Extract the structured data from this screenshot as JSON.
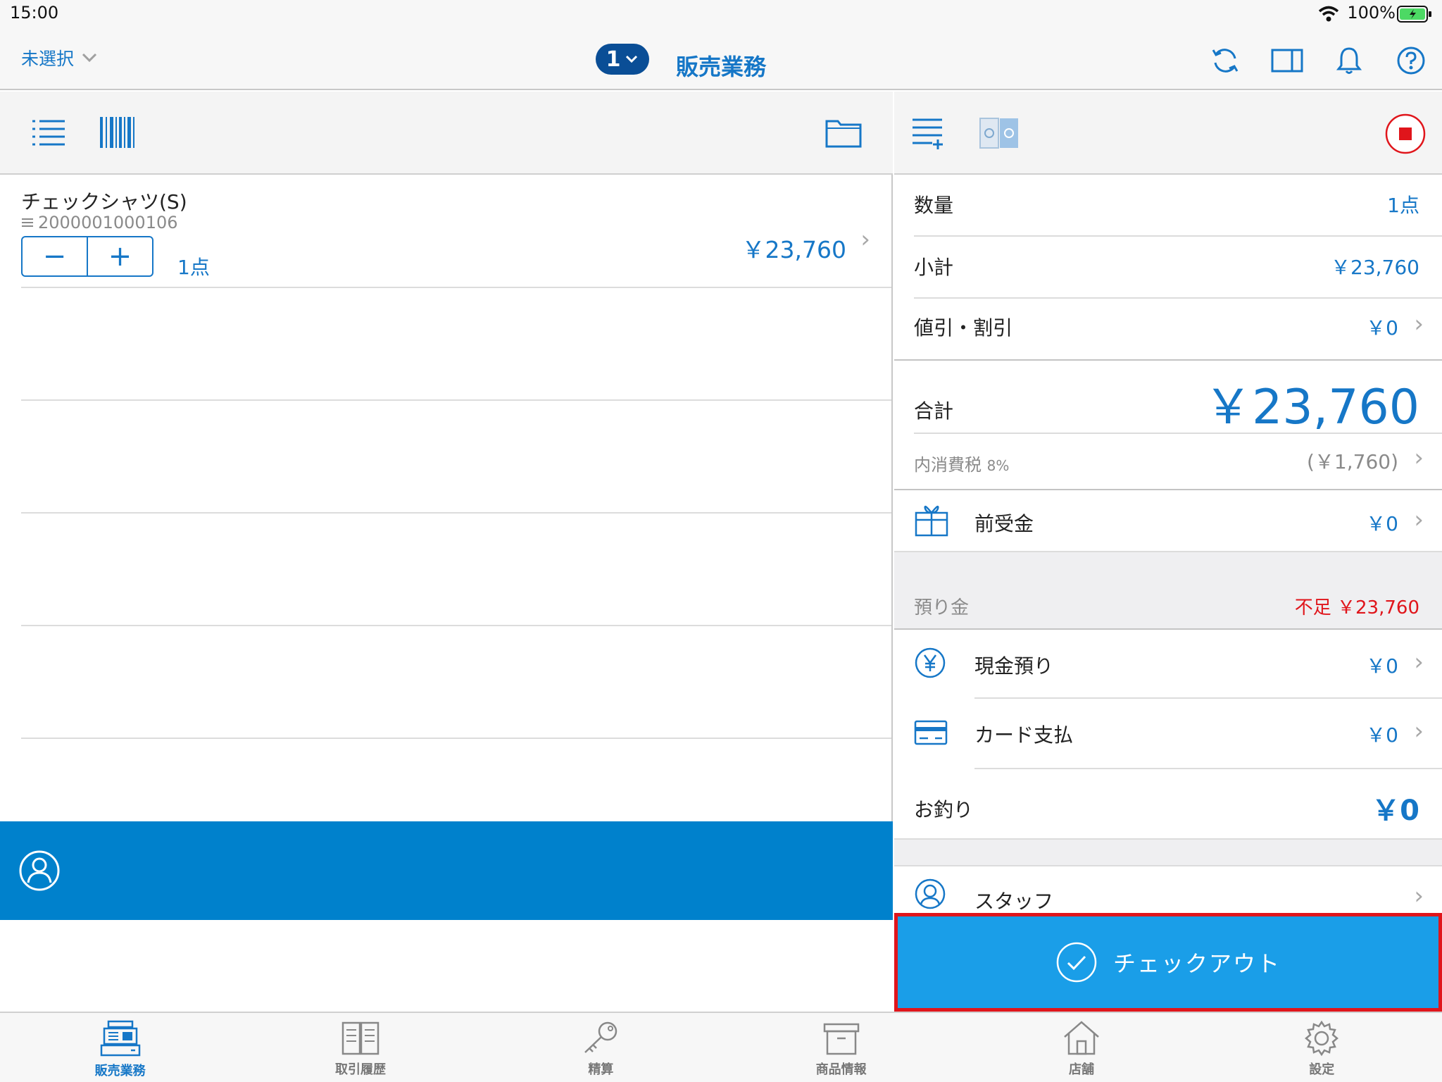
{
  "status_bar": {
    "time": "15:00",
    "battery": "100%"
  },
  "nav": {
    "store_selector": "未選択",
    "register_number": "1",
    "title": "販売業務"
  },
  "line_items": [
    {
      "name": "チェックシャツ(S)",
      "code": "2000001000106",
      "quantity": "1点",
      "price": "￥23,760"
    }
  ],
  "stepper": {
    "minus": "−",
    "plus": "+"
  },
  "summary": {
    "quantity_label": "数量",
    "quantity_value": "1点",
    "subtotal_label": "小計",
    "subtotal_value": "￥23,760",
    "discount_label": "値引・割引",
    "discount_value": "￥0",
    "total_label": "合計",
    "total_value": "￥23,760",
    "tax_label": "内消費税",
    "tax_rate": "8%",
    "tax_value": "(￥1,760)",
    "advance_label": "前受金",
    "advance_value": "￥0",
    "deposit_label": "預り金",
    "shortage_label": "不足",
    "shortage_value": "￥23,760",
    "cash_label": "現金預り",
    "cash_value": "￥0",
    "card_label": "カード支払",
    "card_value": "￥0",
    "change_label": "お釣り",
    "change_value": "￥0",
    "staff_label": "スタッフ"
  },
  "checkout": {
    "label": "チェックアウト"
  },
  "tabs": [
    {
      "label": "販売業務",
      "icon": "register-icon",
      "active": true
    },
    {
      "label": "取引履歴",
      "icon": "book-icon",
      "active": false
    },
    {
      "label": "精算",
      "icon": "key-icon",
      "active": false
    },
    {
      "label": "商品情報",
      "icon": "box-icon",
      "active": false
    },
    {
      "label": "店舗",
      "icon": "house-icon",
      "active": false
    },
    {
      "label": "設定",
      "icon": "gear-icon",
      "active": false
    }
  ],
  "colors": {
    "accent": "#1677c7",
    "customer_bar": "#0081cc",
    "checkout": "#1a9ee8",
    "shortage": "#e0151b"
  }
}
